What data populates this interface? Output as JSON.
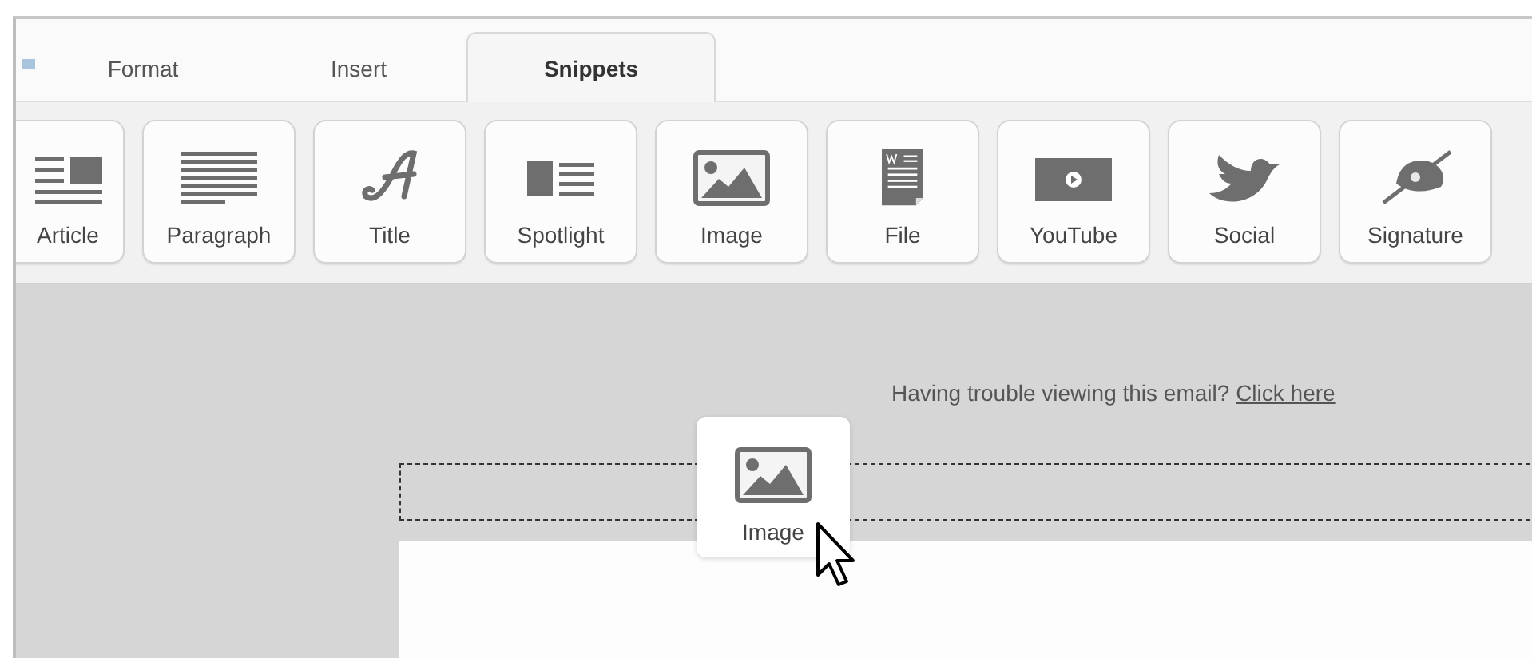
{
  "tabs": [
    {
      "label": "Format",
      "selected": false
    },
    {
      "label": "Insert",
      "selected": false
    },
    {
      "label": "Snippets",
      "selected": true
    }
  ],
  "snippets": [
    {
      "kind": "article",
      "label": "Article"
    },
    {
      "kind": "paragraph",
      "label": "Paragraph"
    },
    {
      "kind": "title",
      "label": "Title"
    },
    {
      "kind": "spotlight",
      "label": "Spotlight"
    },
    {
      "kind": "image",
      "label": "Image"
    },
    {
      "kind": "file",
      "label": "File"
    },
    {
      "kind": "youtube",
      "label": "YouTube"
    },
    {
      "kind": "social",
      "label": "Social"
    },
    {
      "kind": "signature",
      "label": "Signature"
    }
  ],
  "email": {
    "notice": "Having trouble viewing this email?",
    "link": "Click here"
  },
  "drag_preview": {
    "kind": "image",
    "label": "Image"
  }
}
